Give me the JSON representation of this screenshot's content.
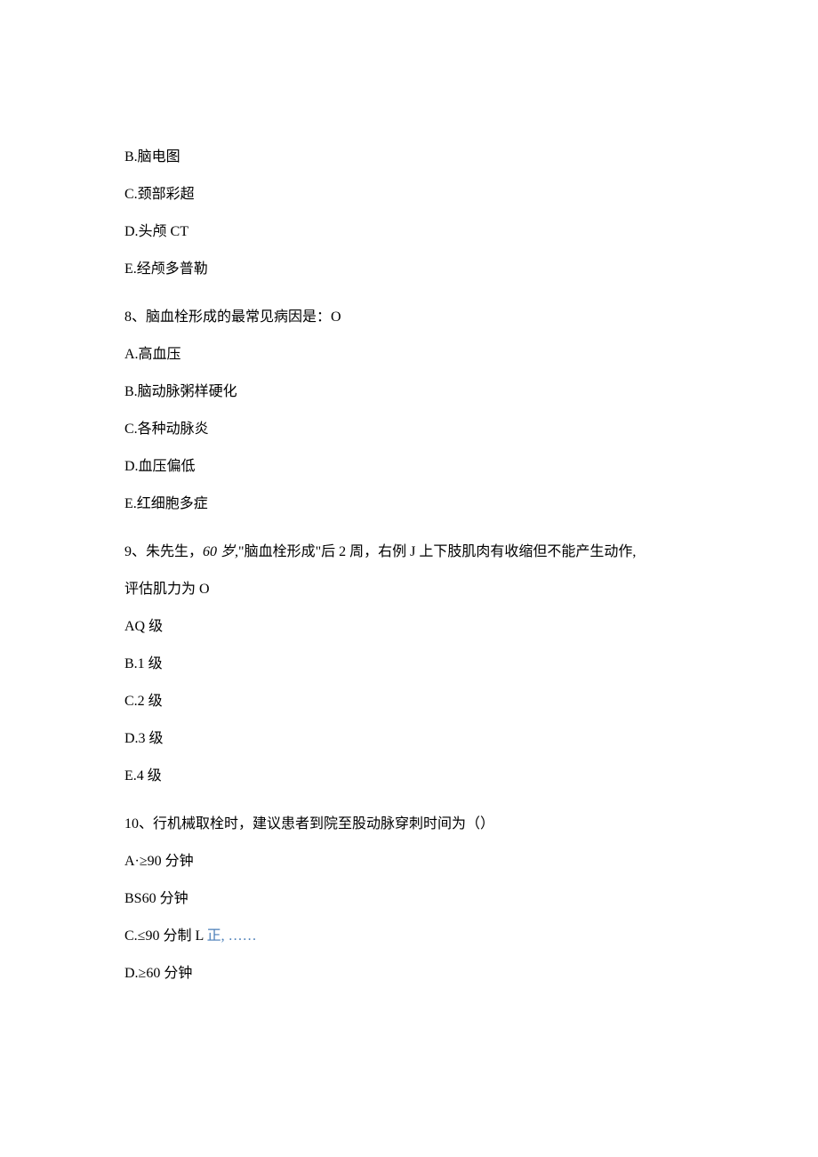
{
  "q7_options": {
    "b": "B.脑电图",
    "c": "C.颈部彩超",
    "d": "D.头颅 CT",
    "e": "E.经颅多普勒"
  },
  "q8": {
    "question": "8、脑血栓形成的最常见病因是：O",
    "options": {
      "a": "A.高血压",
      "b": "B.脑动脉粥样硬化",
      "c": "C.各种动脉炎",
      "d": "D.血压偏低",
      "e": "E.红细胞多症"
    }
  },
  "q9": {
    "question_part1": "9、朱先生，",
    "question_italic": "60 岁,",
    "question_part2": "\"脑血栓形成\"后 2 周，右例 J 上下肢肌肉有收缩但不能产生动作,",
    "question_line2": "评估肌力为 O",
    "options": {
      "a": "AQ 级",
      "b": "B.1 级",
      "c": "C.2 级",
      "d": "D.3 级",
      "e": "E.4 级"
    }
  },
  "q10": {
    "question": "10、行机械取栓时，建议患者到院至股动脉穿刺时间为（）",
    "options": {
      "a": "A·≥90 分钟",
      "b": "BS60 分钟",
      "c_part1": "C.≤90 分制 L ",
      "c_blue": "正, ……",
      "d": "D.≥60 分钟"
    }
  }
}
